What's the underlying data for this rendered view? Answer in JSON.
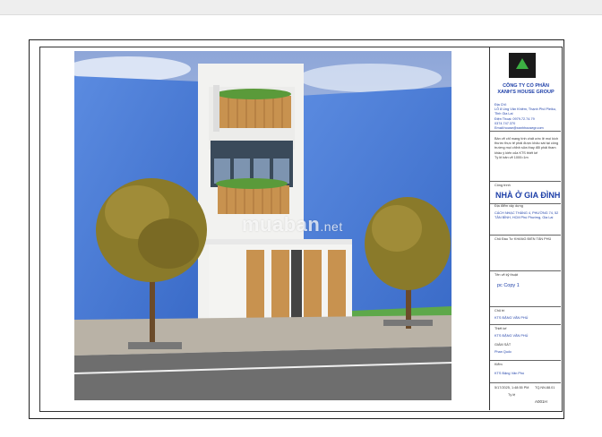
{
  "titleblock": {
    "company_line1": "CÔNG TY CỔ PHẦN",
    "company_line2": "XANH'S HOUSE GROUP",
    "address_label": "Địa Chỉ:",
    "address": "LÔ 8 Ung Văn Khiêm, Thạnh Phố Pleiku, Tỉnh Gia Lai",
    "phone_label": "Điện Thoại: 0979.72.74.79",
    "phone2": "0374.747.370",
    "email": "Email:house@xanhhousegr.com",
    "note": "Bản vẽ chỉ mang tính chất ước lệ mọi kích thước thực tế phải được khảo sát tại công trường mọi chỉnh sửa thay đổi phải tham khảo ý kiến của KTS thiết kế",
    "scale": "Tỷ lệ bản vẽ 1000=1m",
    "project_label": "Công trình",
    "project": "NHÀ Ở GIA ĐÌNH",
    "location_label": "Địa điểm xây dựng",
    "location": "CÁCH NHẠC THÁNG 4, PHƯỜNG 74, 52 TÂN BÌNH, HCM Phú Phường, Gia Lai",
    "owner_label": "Chủ Đầu Tư",
    "owner": "KHANG ĐIỀN TÂN PHÚ",
    "drawing_label": "Tên vẽ kỹ thuật",
    "drawing": "pc Copy 1",
    "chief_label": "Chủ trì",
    "chief": "KTS ĐẶNG VĂN PHÚ",
    "designer_label": "Thiết kế",
    "designer": "KTS ĐẶNG VĂN PHÚ",
    "supervisor_label": "GIÁM SÁT",
    "supervisor": "Phan Quốc",
    "review_label": "Kiểm",
    "review": "KTS Đặng Văn Phú",
    "date": "5/17/2025, 1:48:55 PM",
    "code": "TQ.NN.88.01",
    "scale_small": "Tỷ lệ",
    "sheet_no": "A001H"
  },
  "watermark": {
    "main": "muaban",
    "suffix": ".net"
  },
  "colors": {
    "sky": "#9fb6e0",
    "blue_wall": "#4f7fd8",
    "grass": "#5ea84a",
    "road": "#7a7a7a",
    "wood": "#c8924f",
    "brand_blue": "#1d3fa8"
  }
}
